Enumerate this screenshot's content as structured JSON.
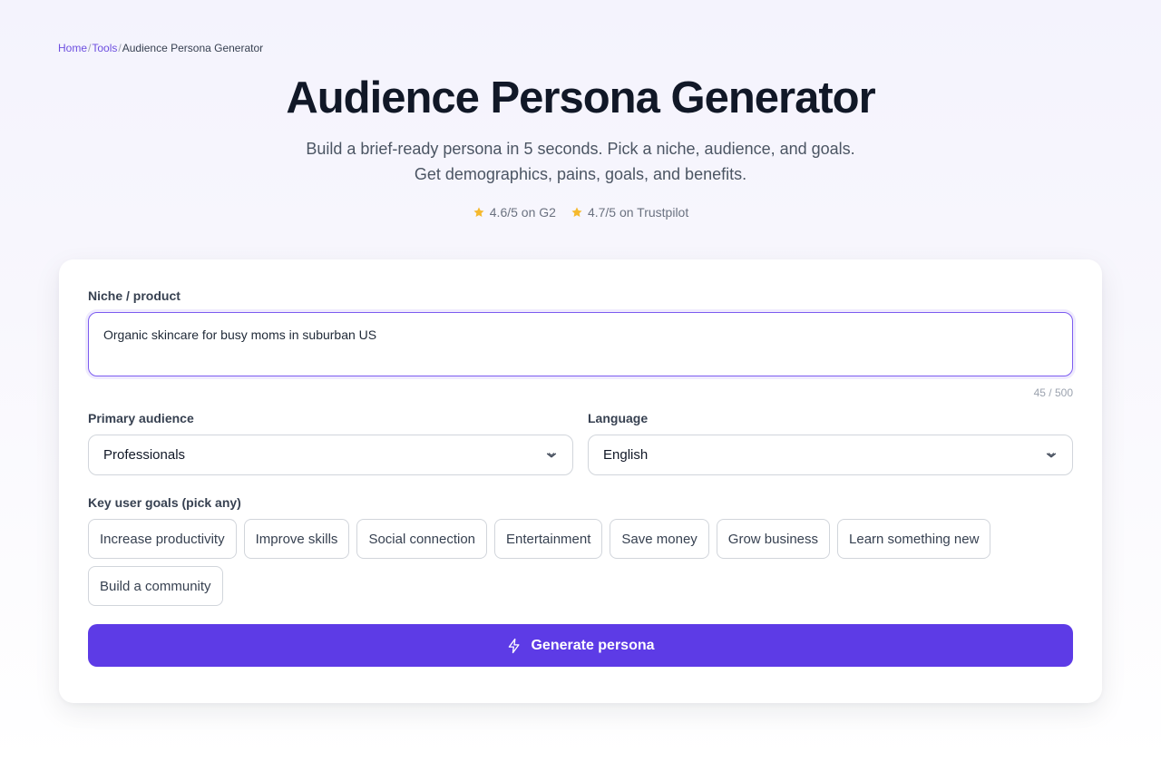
{
  "breadcrumb": {
    "items": [
      "Home",
      "Tools",
      "Audience Persona Generator"
    ],
    "separator": "/"
  },
  "hero": {
    "title": "Audience Persona Generator",
    "subtitle_line1": "Build a brief-ready persona in 5 seconds. Pick a niche, audience, and goals.",
    "subtitle_line2": "Get demographics, pains, goals, and benefits."
  },
  "ratings": [
    {
      "icon": "star-icon",
      "text": "4.6/5 on G2"
    },
    {
      "icon": "star-icon",
      "text": "4.7/5 on Trustpilot"
    }
  ],
  "form": {
    "niche_label": "Niche / product",
    "niche_value": "Organic skincare for busy moms in suburban US",
    "niche_counter": "45 / 500",
    "audience_label": "Primary audience",
    "audience_value": "Professionals",
    "language_label": "Language",
    "language_value": "English",
    "goals_label": "Key user goals (pick any)",
    "goals": [
      "Increase productivity",
      "Improve skills",
      "Social connection",
      "Entertainment",
      "Save money",
      "Grow business",
      "Learn something new",
      "Build a community"
    ],
    "generate_label": "Generate persona"
  },
  "colors": {
    "accent": "#5d3be6",
    "link": "#6d4fe0",
    "star": "#f5b92e"
  }
}
